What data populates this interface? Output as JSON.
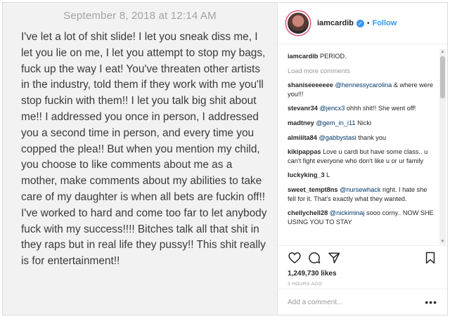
{
  "note": {
    "date": "September 8, 2018 at 12:14 AM",
    "body": "I've let a lot of shit slide! I let you sneak diss me, I let you lie on me, I let you attempt to stop my bags, fuck up the way I eat! You've threaten other artists in the industry, told them if they work with me you'll stop fuckin with them!! I let you talk big shit about me!! I addressed you once in person, I addressed you a second time in person, and every time you copped the plea!! But when you mention my child, you choose to like comments about me as a mother, make comments about my abilities to take care of my daughter is when all bets are fuckin off!! I've worked to hard and come too far to let anybody fuck with my success!!!! Bitches talk all that shit in they raps but in real life they pussy!! This shit really is for entertainment!!"
  },
  "post": {
    "username": "iamcardib",
    "verified_glyph": "✓",
    "dot": "•",
    "follow_label": "Follow",
    "caption_user": "iamcardib",
    "caption_text": "PERIOD.",
    "load_more": "Load more comments",
    "comments": [
      {
        "user": "shaniseeeeeee",
        "mention": "@hennessycarolina",
        "text": "& where were you!!!"
      },
      {
        "user": "stevanr34",
        "mention": "@jencx3",
        "text": "ohhh shit!! She went off!"
      },
      {
        "user": "madtney",
        "mention": "@gem_in_i11",
        "text": "Nicki"
      },
      {
        "user": "almiiita84",
        "mention": "@gabbystasi",
        "text": "thank you"
      },
      {
        "user": "kikipappas",
        "mention": "",
        "text": "Love u cardi but have some class.. u can't fight everyone who don't like u or ur family"
      },
      {
        "user": "luckyking_3",
        "mention": "",
        "text": "L"
      },
      {
        "user": "sweet_tempt8ns",
        "mention": "@nursewhack",
        "text": "right. I hate she fell for it. That's exactly what they wanted."
      },
      {
        "user": "chellychell28",
        "mention": "@nickiminaj",
        "text": "sooo corny.. NOW SHE USING YOU TO STAY"
      }
    ],
    "likes": "1,249,730 likes",
    "time": "3 HOURS AGO",
    "add_comment_placeholder": "Add a comment...",
    "more_options": "•••",
    "icons": [
      "heart-icon",
      "comment-icon",
      "share-icon",
      "bookmark-icon"
    ]
  }
}
